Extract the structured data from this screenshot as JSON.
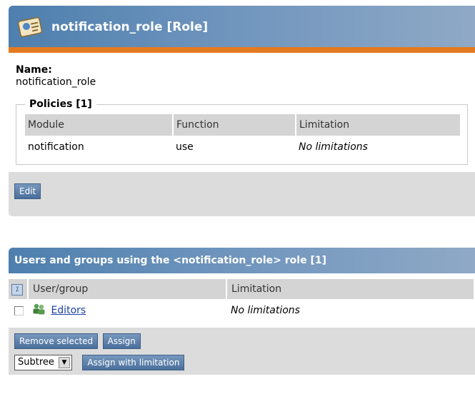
{
  "role_panel": {
    "title": "notification_role [Role]",
    "name_label": "Name:",
    "name_value": "notification_role",
    "policies_legend": "Policies [1]",
    "columns": [
      "Module",
      "Function",
      "Limitation"
    ],
    "rows": [
      {
        "module": "notification",
        "function": "use",
        "limitation": "No limitations"
      }
    ],
    "edit_button": "Edit"
  },
  "assign_panel": {
    "title": "Users and groups using the <notification_role> role [1]",
    "toggle_icon": "invert-selection-icon",
    "columns": [
      "User/group",
      "Limitation"
    ],
    "rows": [
      {
        "name": "Editors",
        "limitation": "No limitations",
        "icon": "user-group-icon"
      }
    ],
    "remove_button": "Remove selected",
    "assign_button": "Assign",
    "limitation_select": "Subtree",
    "assign_with_limitation_button": "Assign with limitation"
  },
  "colors": {
    "header_blue": "#4e7fae",
    "accent_orange": "#e47a1f",
    "button_blue": "#4a6f9c",
    "link_blue": "#1a3fa8"
  }
}
